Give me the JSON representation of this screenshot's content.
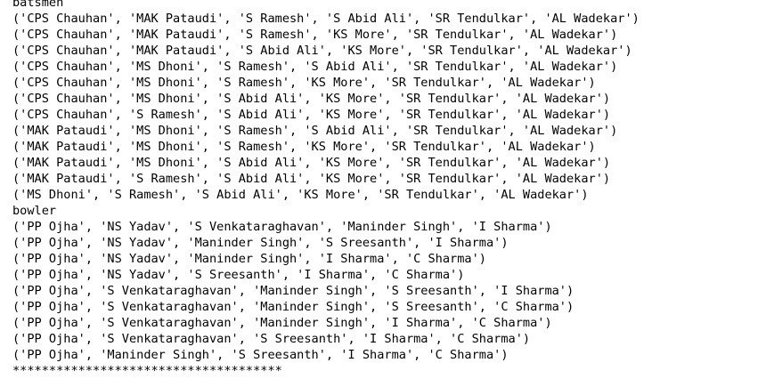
{
  "console": {
    "lines": [
      "batsmen",
      "('CPS Chauhan', 'MAK Pataudi', 'S Ramesh', 'S Abid Ali', 'SR Tendulkar', 'AL Wadekar')",
      "('CPS Chauhan', 'MAK Pataudi', 'S Ramesh', 'KS More', 'SR Tendulkar', 'AL Wadekar')",
      "('CPS Chauhan', 'MAK Pataudi', 'S Abid Ali', 'KS More', 'SR Tendulkar', 'AL Wadekar')",
      "('CPS Chauhan', 'MS Dhoni', 'S Ramesh', 'S Abid Ali', 'SR Tendulkar', 'AL Wadekar')",
      "('CPS Chauhan', 'MS Dhoni', 'S Ramesh', 'KS More', 'SR Tendulkar', 'AL Wadekar')",
      "('CPS Chauhan', 'MS Dhoni', 'S Abid Ali', 'KS More', 'SR Tendulkar', 'AL Wadekar')",
      "('CPS Chauhan', 'S Ramesh', 'S Abid Ali', 'KS More', 'SR Tendulkar', 'AL Wadekar')",
      "('MAK Pataudi', 'MS Dhoni', 'S Ramesh', 'S Abid Ali', 'SR Tendulkar', 'AL Wadekar')",
      "('MAK Pataudi', 'MS Dhoni', 'S Ramesh', 'KS More', 'SR Tendulkar', 'AL Wadekar')",
      "('MAK Pataudi', 'MS Dhoni', 'S Abid Ali', 'KS More', 'SR Tendulkar', 'AL Wadekar')",
      "('MAK Pataudi', 'S Ramesh', 'S Abid Ali', 'KS More', 'SR Tendulkar', 'AL Wadekar')",
      "('MS Dhoni', 'S Ramesh', 'S Abid Ali', 'KS More', 'SR Tendulkar', 'AL Wadekar')",
      "bowler",
      "('PP Ojha', 'NS Yadav', 'S Venkataraghavan', 'Maninder Singh', 'I Sharma')",
      "('PP Ojha', 'NS Yadav', 'Maninder Singh', 'S Sreesanth', 'I Sharma')",
      "('PP Ojha', 'NS Yadav', 'Maninder Singh', 'I Sharma', 'C Sharma')",
      "('PP Ojha', 'NS Yadav', 'S Sreesanth', 'I Sharma', 'C Sharma')",
      "('PP Ojha', 'S Venkataraghavan', 'Maninder Singh', 'S Sreesanth', 'I Sharma')",
      "('PP Ojha', 'S Venkataraghavan', 'Maninder Singh', 'S Sreesanth', 'C Sharma')",
      "('PP Ojha', 'S Venkataraghavan', 'Maninder Singh', 'I Sharma', 'C Sharma')",
      "('PP Ojha', 'S Venkataraghavan', 'S Sreesanth', 'I Sharma', 'C Sharma')",
      "('PP Ojha', 'Maninder Singh', 'S Sreesanth', 'I Sharma', 'C Sharma')",
      "*************************************"
    ]
  }
}
